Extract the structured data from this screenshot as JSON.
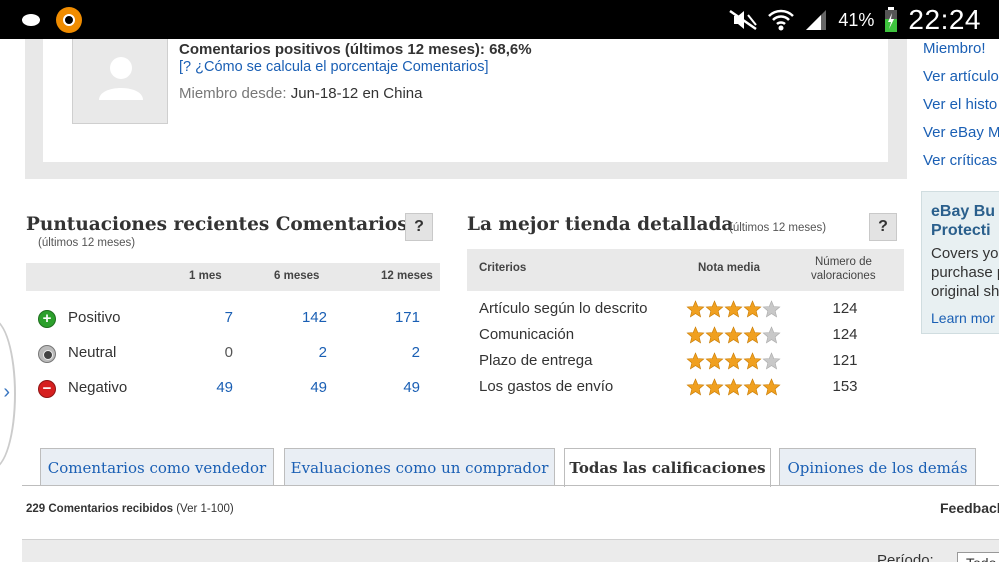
{
  "status_bar": {
    "battery_percent": "41%",
    "time": "22:24"
  },
  "profile": {
    "positive_feedback": "Comentarios positivos (últimos 12 meses): 68,6%",
    "how_calculated_link": "[? ¿Cómo se calcula el porcentaje Comentarios]",
    "member_since_label": "Miembro desde:",
    "member_since_value": "Jun-18-12 en China"
  },
  "right_links": [
    "Miembro!",
    "Ver artículo",
    "Ver el histo",
    "Ver eBay M",
    "Ver críticas"
  ],
  "ad": {
    "title_line1": "eBay Bu",
    "title_line2": "Protecti",
    "body_line1": "Covers you",
    "body_line2": "purchase p",
    "body_line3": "original sh",
    "link": "Learn mor"
  },
  "recent_ratings": {
    "title": "Puntuaciones recientes Comentarios",
    "subtitle": "(últimos 12 meses)",
    "help": "?",
    "columns": [
      "1 mes",
      "6 meses",
      "12 meses"
    ],
    "rows": [
      {
        "label": "Positivo",
        "values": [
          "7",
          "142",
          "171"
        ]
      },
      {
        "label": "Neutral",
        "values": [
          "0",
          "2",
          "2"
        ]
      },
      {
        "label": "Negativo",
        "values": [
          "49",
          "49",
          "49"
        ]
      }
    ]
  },
  "detailed_ratings": {
    "title": "La mejor tienda detallada",
    "subtitle": "(últimos 12 meses)",
    "help": "?",
    "col_criteria": "Criterios",
    "col_average": "Nota media",
    "col_count_line1": "Número de",
    "col_count_line2": "valoraciones",
    "rows": [
      {
        "criterion": "Artículo según lo descrito",
        "stars": 4,
        "count": "124"
      },
      {
        "criterion": "Comunicación",
        "stars": 4,
        "count": "124"
      },
      {
        "criterion": "Plazo de entrega",
        "stars": 4,
        "count": "121"
      },
      {
        "criterion": "Los gastos de envío",
        "stars": 5,
        "count": "153"
      }
    ]
  },
  "tabs": [
    {
      "label": "Comentarios como vendedor",
      "active": false
    },
    {
      "label": "Evaluaciones como un comprador",
      "active": false
    },
    {
      "label": "Todas las calificaciones",
      "active": true
    },
    {
      "label": "Opiniones de los demás",
      "active": false
    }
  ],
  "received": {
    "count_text": "229 Comentarios recibidos",
    "range_text": "(Ver 1-100)"
  },
  "feedback_right": "Feedback",
  "period": {
    "label": "Período:",
    "value": "Todo"
  },
  "colors": {
    "link": "#1a5fb4",
    "star_filled": "#f0a020",
    "star_empty": "#c8c8c8"
  }
}
